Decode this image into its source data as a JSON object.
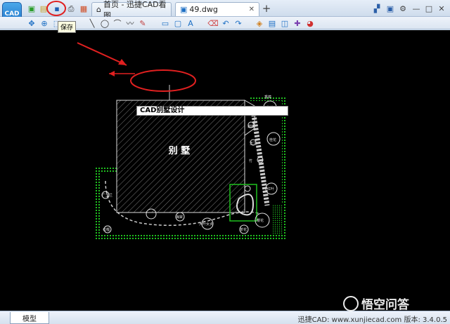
{
  "toolbar": {
    "save_tooltip": "保存"
  },
  "tabs": [
    {
      "label": "首页 - 迅捷CAD看图"
    },
    {
      "label": "49.dwg"
    }
  ],
  "drawing": {
    "title_text": "CAD别墅设计",
    "villa_label": "别 墅",
    "plant_labels": [
      "香樟",
      "紫薇",
      "蜡梅",
      "桂花",
      "玉兰",
      "红叶",
      "樱花",
      "茶花",
      "海棠",
      "竹",
      "广玉兰",
      "大叶女贞",
      "石榴"
    ]
  },
  "status": {
    "model_tab": "模型",
    "info": "迅捷CAD: www.xunjiecad.com 版本: 3.4.0.5"
  },
  "watermark": {
    "text": "悟空问答"
  },
  "colors": {
    "canvas_bg": "#000000",
    "hedge_green": "#1fbf1f",
    "annotation_red": "#e02020"
  }
}
